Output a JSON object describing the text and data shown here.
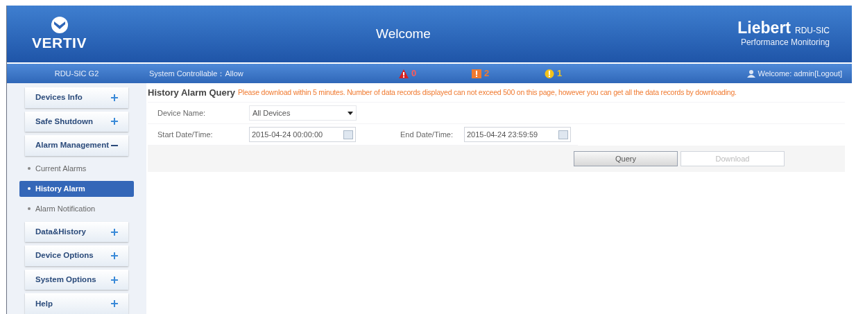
{
  "header": {
    "brand": "VERTIV",
    "title": "Welcome",
    "product_name": "Liebert",
    "product_model": "RDU-SIC",
    "product_tagline": "Performance Monitoring"
  },
  "status_bar": {
    "device": "RDU-SIC G2",
    "controllable": "System Controllable：Allow",
    "alarms": [
      {
        "kind": "critical",
        "count": "0"
      },
      {
        "kind": "major",
        "count": "2"
      },
      {
        "kind": "minor",
        "count": "1"
      }
    ],
    "user": "Welcome: admin[Logout]"
  },
  "sidebar": {
    "items": [
      {
        "label": "Devices Info",
        "expanded": false
      },
      {
        "label": "Safe Shutdown",
        "expanded": false
      },
      {
        "label": "Alarm Management",
        "expanded": true,
        "children": [
          {
            "label": "Current Alarms",
            "selected": false
          },
          {
            "label": "History Alarm",
            "selected": true
          },
          {
            "label": "Alarm Notification",
            "selected": false
          }
        ]
      },
      {
        "label": "Data&History",
        "expanded": false
      },
      {
        "label": "Device Options",
        "expanded": false
      },
      {
        "label": "System Options",
        "expanded": false
      },
      {
        "label": "Help",
        "expanded": false
      }
    ]
  },
  "query": {
    "title": "History Alarm Query",
    "notice": "Please download within 5 minutes. Number of data records displayed can not exceed 500 on this page, however you can get all the data records by downloading.",
    "device_label": "Device Name:",
    "device_value": "All Devices",
    "start_label": "Start Date/Time:",
    "start_value": "2015-04-24 00:00:00",
    "end_label": "End Date/Time:",
    "end_value": "2015-04-24 23:59:59",
    "buttons": [
      {
        "label": "Query",
        "disabled": false
      },
      {
        "label": "Download",
        "disabled": true
      }
    ]
  }
}
